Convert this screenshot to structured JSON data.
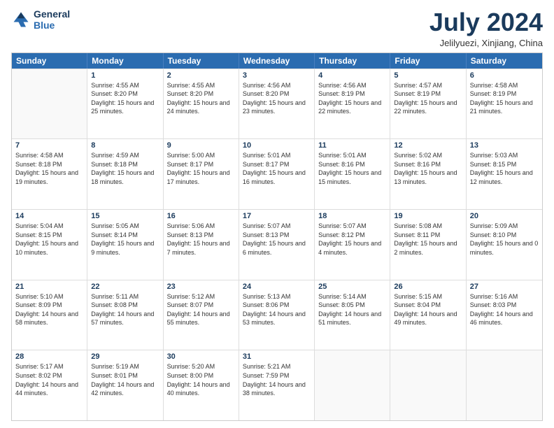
{
  "header": {
    "logo_line1": "General",
    "logo_line2": "Blue",
    "month": "July 2024",
    "location": "Jelilyuezi, Xinjiang, China"
  },
  "days_of_week": [
    "Sunday",
    "Monday",
    "Tuesday",
    "Wednesday",
    "Thursday",
    "Friday",
    "Saturday"
  ],
  "weeks": [
    [
      {
        "day": null
      },
      {
        "day": "1",
        "rise": "4:55 AM",
        "set": "8:20 PM",
        "daylight": "15 hours and 25 minutes."
      },
      {
        "day": "2",
        "rise": "4:55 AM",
        "set": "8:20 PM",
        "daylight": "15 hours and 24 minutes."
      },
      {
        "day": "3",
        "rise": "4:56 AM",
        "set": "8:20 PM",
        "daylight": "15 hours and 23 minutes."
      },
      {
        "day": "4",
        "rise": "4:56 AM",
        "set": "8:19 PM",
        "daylight": "15 hours and 22 minutes."
      },
      {
        "day": "5",
        "rise": "4:57 AM",
        "set": "8:19 PM",
        "daylight": "15 hours and 22 minutes."
      },
      {
        "day": "6",
        "rise": "4:58 AM",
        "set": "8:19 PM",
        "daylight": "15 hours and 21 minutes."
      }
    ],
    [
      {
        "day": "7",
        "rise": "4:58 AM",
        "set": "8:18 PM",
        "daylight": "15 hours and 19 minutes."
      },
      {
        "day": "8",
        "rise": "4:59 AM",
        "set": "8:18 PM",
        "daylight": "15 hours and 18 minutes."
      },
      {
        "day": "9",
        "rise": "5:00 AM",
        "set": "8:17 PM",
        "daylight": "15 hours and 17 minutes."
      },
      {
        "day": "10",
        "rise": "5:01 AM",
        "set": "8:17 PM",
        "daylight": "15 hours and 16 minutes."
      },
      {
        "day": "11",
        "rise": "5:01 AM",
        "set": "8:16 PM",
        "daylight": "15 hours and 15 minutes."
      },
      {
        "day": "12",
        "rise": "5:02 AM",
        "set": "8:16 PM",
        "daylight": "15 hours and 13 minutes."
      },
      {
        "day": "13",
        "rise": "5:03 AM",
        "set": "8:15 PM",
        "daylight": "15 hours and 12 minutes."
      }
    ],
    [
      {
        "day": "14",
        "rise": "5:04 AM",
        "set": "8:15 PM",
        "daylight": "15 hours and 10 minutes."
      },
      {
        "day": "15",
        "rise": "5:05 AM",
        "set": "8:14 PM",
        "daylight": "15 hours and 9 minutes."
      },
      {
        "day": "16",
        "rise": "5:06 AM",
        "set": "8:13 PM",
        "daylight": "15 hours and 7 minutes."
      },
      {
        "day": "17",
        "rise": "5:07 AM",
        "set": "8:13 PM",
        "daylight": "15 hours and 6 minutes."
      },
      {
        "day": "18",
        "rise": "5:07 AM",
        "set": "8:12 PM",
        "daylight": "15 hours and 4 minutes."
      },
      {
        "day": "19",
        "rise": "5:08 AM",
        "set": "8:11 PM",
        "daylight": "15 hours and 2 minutes."
      },
      {
        "day": "20",
        "rise": "5:09 AM",
        "set": "8:10 PM",
        "daylight": "15 hours and 0 minutes."
      }
    ],
    [
      {
        "day": "21",
        "rise": "5:10 AM",
        "set": "8:09 PM",
        "daylight": "14 hours and 58 minutes."
      },
      {
        "day": "22",
        "rise": "5:11 AM",
        "set": "8:08 PM",
        "daylight": "14 hours and 57 minutes."
      },
      {
        "day": "23",
        "rise": "5:12 AM",
        "set": "8:07 PM",
        "daylight": "14 hours and 55 minutes."
      },
      {
        "day": "24",
        "rise": "5:13 AM",
        "set": "8:06 PM",
        "daylight": "14 hours and 53 minutes."
      },
      {
        "day": "25",
        "rise": "5:14 AM",
        "set": "8:05 PM",
        "daylight": "14 hours and 51 minutes."
      },
      {
        "day": "26",
        "rise": "5:15 AM",
        "set": "8:04 PM",
        "daylight": "14 hours and 49 minutes."
      },
      {
        "day": "27",
        "rise": "5:16 AM",
        "set": "8:03 PM",
        "daylight": "14 hours and 46 minutes."
      }
    ],
    [
      {
        "day": "28",
        "rise": "5:17 AM",
        "set": "8:02 PM",
        "daylight": "14 hours and 44 minutes."
      },
      {
        "day": "29",
        "rise": "5:19 AM",
        "set": "8:01 PM",
        "daylight": "14 hours and 42 minutes."
      },
      {
        "day": "30",
        "rise": "5:20 AM",
        "set": "8:00 PM",
        "daylight": "14 hours and 40 minutes."
      },
      {
        "day": "31",
        "rise": "5:21 AM",
        "set": "7:59 PM",
        "daylight": "14 hours and 38 minutes."
      },
      {
        "day": null
      },
      {
        "day": null
      },
      {
        "day": null
      }
    ]
  ]
}
